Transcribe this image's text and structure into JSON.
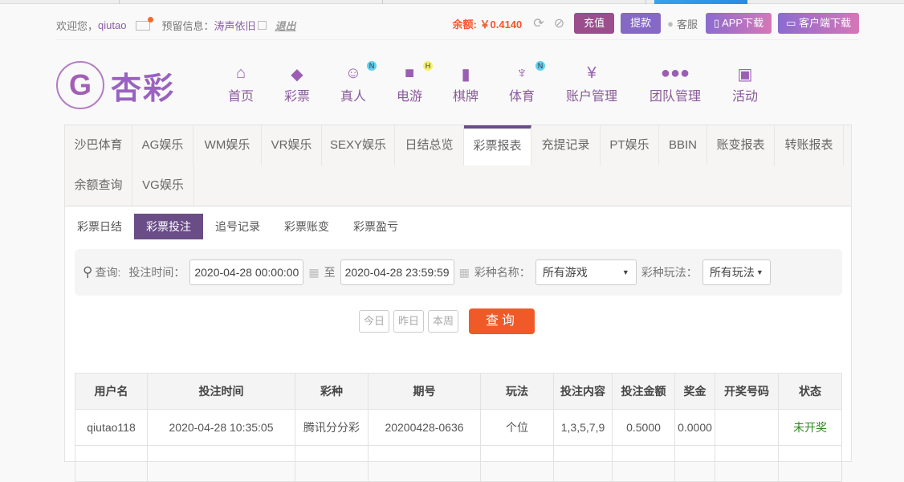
{
  "topbar": {
    "welcome": "欢迎您，",
    "username": "qiutao",
    "reserved_label": "预留信息：",
    "reserved_value": "涛声依旧",
    "logout": "退出",
    "balance_label": "余额:",
    "balance": "￥0.4140",
    "recharge": "充值",
    "withdraw": "提款",
    "service": "客服",
    "app_download": "APP下载",
    "client_download": "客户端下载"
  },
  "logo": {
    "text": "杏彩"
  },
  "nav": [
    {
      "label": "首页",
      "icon": "home-icon"
    },
    {
      "label": "彩票",
      "icon": "ticket-icon"
    },
    {
      "label": "真人",
      "icon": "dealer-icon",
      "badge": "N"
    },
    {
      "label": "电游",
      "icon": "gamepad-icon",
      "badge": "H"
    },
    {
      "label": "棋牌",
      "icon": "cards-icon"
    },
    {
      "label": "体育",
      "icon": "trophy-icon",
      "badge": "N"
    },
    {
      "label": "账户管理",
      "icon": "yen-icon"
    },
    {
      "label": "团队管理",
      "icon": "team-icon"
    },
    {
      "label": "活动",
      "icon": "gift-icon"
    }
  ],
  "tabs": [
    "沙巴体育",
    "AG娱乐",
    "WM娱乐",
    "VR娱乐",
    "SEXY娱乐",
    "日结总览",
    "彩票报表",
    "充提记录",
    "PT娱乐",
    "BBIN",
    "账变报表",
    "转账报表",
    "余额查询",
    "VG娱乐"
  ],
  "subtabs": [
    "彩票日结",
    "彩票投注",
    "追号记录",
    "彩票账变",
    "彩票盈亏"
  ],
  "filter": {
    "query_label": "查询:",
    "time_label": "投注时间：",
    "start": "2020-04-28 00:00:00",
    "to": "至",
    "end": "2020-04-28 23:59:59",
    "lottery_label": "彩种名称：",
    "lottery_value": "所有游戏",
    "play_label": "彩种玩法：",
    "play_value": "所有玩法",
    "today": "今日",
    "yesterday": "昨日",
    "week": "本周",
    "search": "查询"
  },
  "table": {
    "headers": [
      "用户名",
      "投注时间",
      "彩种",
      "期号",
      "玩法",
      "投注内容",
      "投注金额",
      "奖金",
      "开奖号码",
      "状态"
    ],
    "rows": [
      [
        "qiutao118",
        "2020-04-28 10:35:05",
        "腾讯分分彩",
        "20200428-0636",
        "个位",
        "1,3,5,7,9",
        "0.5000",
        "0.0000",
        "",
        "未开奖"
      ]
    ]
  },
  "colors": {
    "accent": "#6a4d87",
    "orange": "#ef5a28",
    "balance": "#f2582d"
  }
}
